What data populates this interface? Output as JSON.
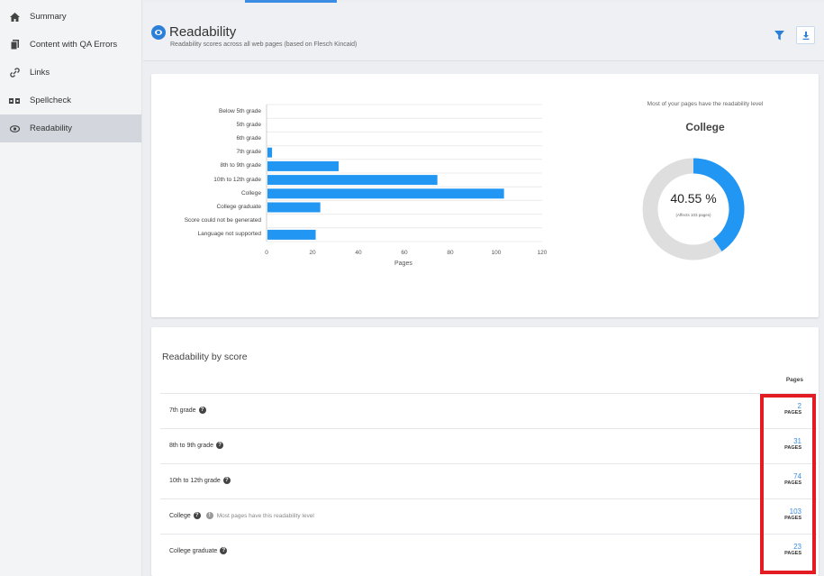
{
  "sidebar": {
    "items": [
      {
        "label": "Summary",
        "icon": "home-icon"
      },
      {
        "label": "Content with QA Errors",
        "icon": "document-icon"
      },
      {
        "label": "Links",
        "icon": "link-icon"
      },
      {
        "label": "Spellcheck",
        "icon": "spellcheck-icon"
      },
      {
        "label": "Readability",
        "icon": "eye-icon",
        "active": true
      }
    ]
  },
  "header": {
    "title": "Readability",
    "subtitle": "Readability scores across all web pages (based on Flesch Kincaid)"
  },
  "chart_data": {
    "type": "bar",
    "orientation": "horizontal",
    "categories": [
      "Below 5th grade",
      "5th grade",
      "6th grade",
      "7th grade",
      "8th to 9th grade",
      "10th to 12th grade",
      "College",
      "College graduate",
      "Score could not be generated",
      "Language not supported"
    ],
    "values": [
      0,
      0,
      0,
      2,
      31,
      74,
      103,
      23,
      0,
      21
    ],
    "xlabel": "Pages",
    "xlim": [
      0,
      120
    ],
    "xticks": [
      0,
      20,
      40,
      60,
      80,
      100,
      120
    ],
    "color": "#2196f3",
    "grid": true
  },
  "donut": {
    "intro": "Most of your pages have the readability level",
    "level": "College",
    "percent_label": "40.55 %",
    "percent": 40.55,
    "note": "(Affects 103 pages)",
    "fill_color": "#2196f3",
    "track_color": "#dedede"
  },
  "table": {
    "title": "Readability by score",
    "column_header": "Pages",
    "unit": "PAGES",
    "rows": [
      {
        "label": "7th grade",
        "pages": "2"
      },
      {
        "label": "8th to 9th grade",
        "pages": "31"
      },
      {
        "label": "10th to 12th grade",
        "pages": "74"
      },
      {
        "label": "College",
        "pages": "103",
        "note": "Most pages have this readability level"
      },
      {
        "label": "College graduate",
        "pages": "23"
      }
    ]
  },
  "colors": {
    "accent": "#2b7fd8",
    "highlight": "#e31b23"
  }
}
